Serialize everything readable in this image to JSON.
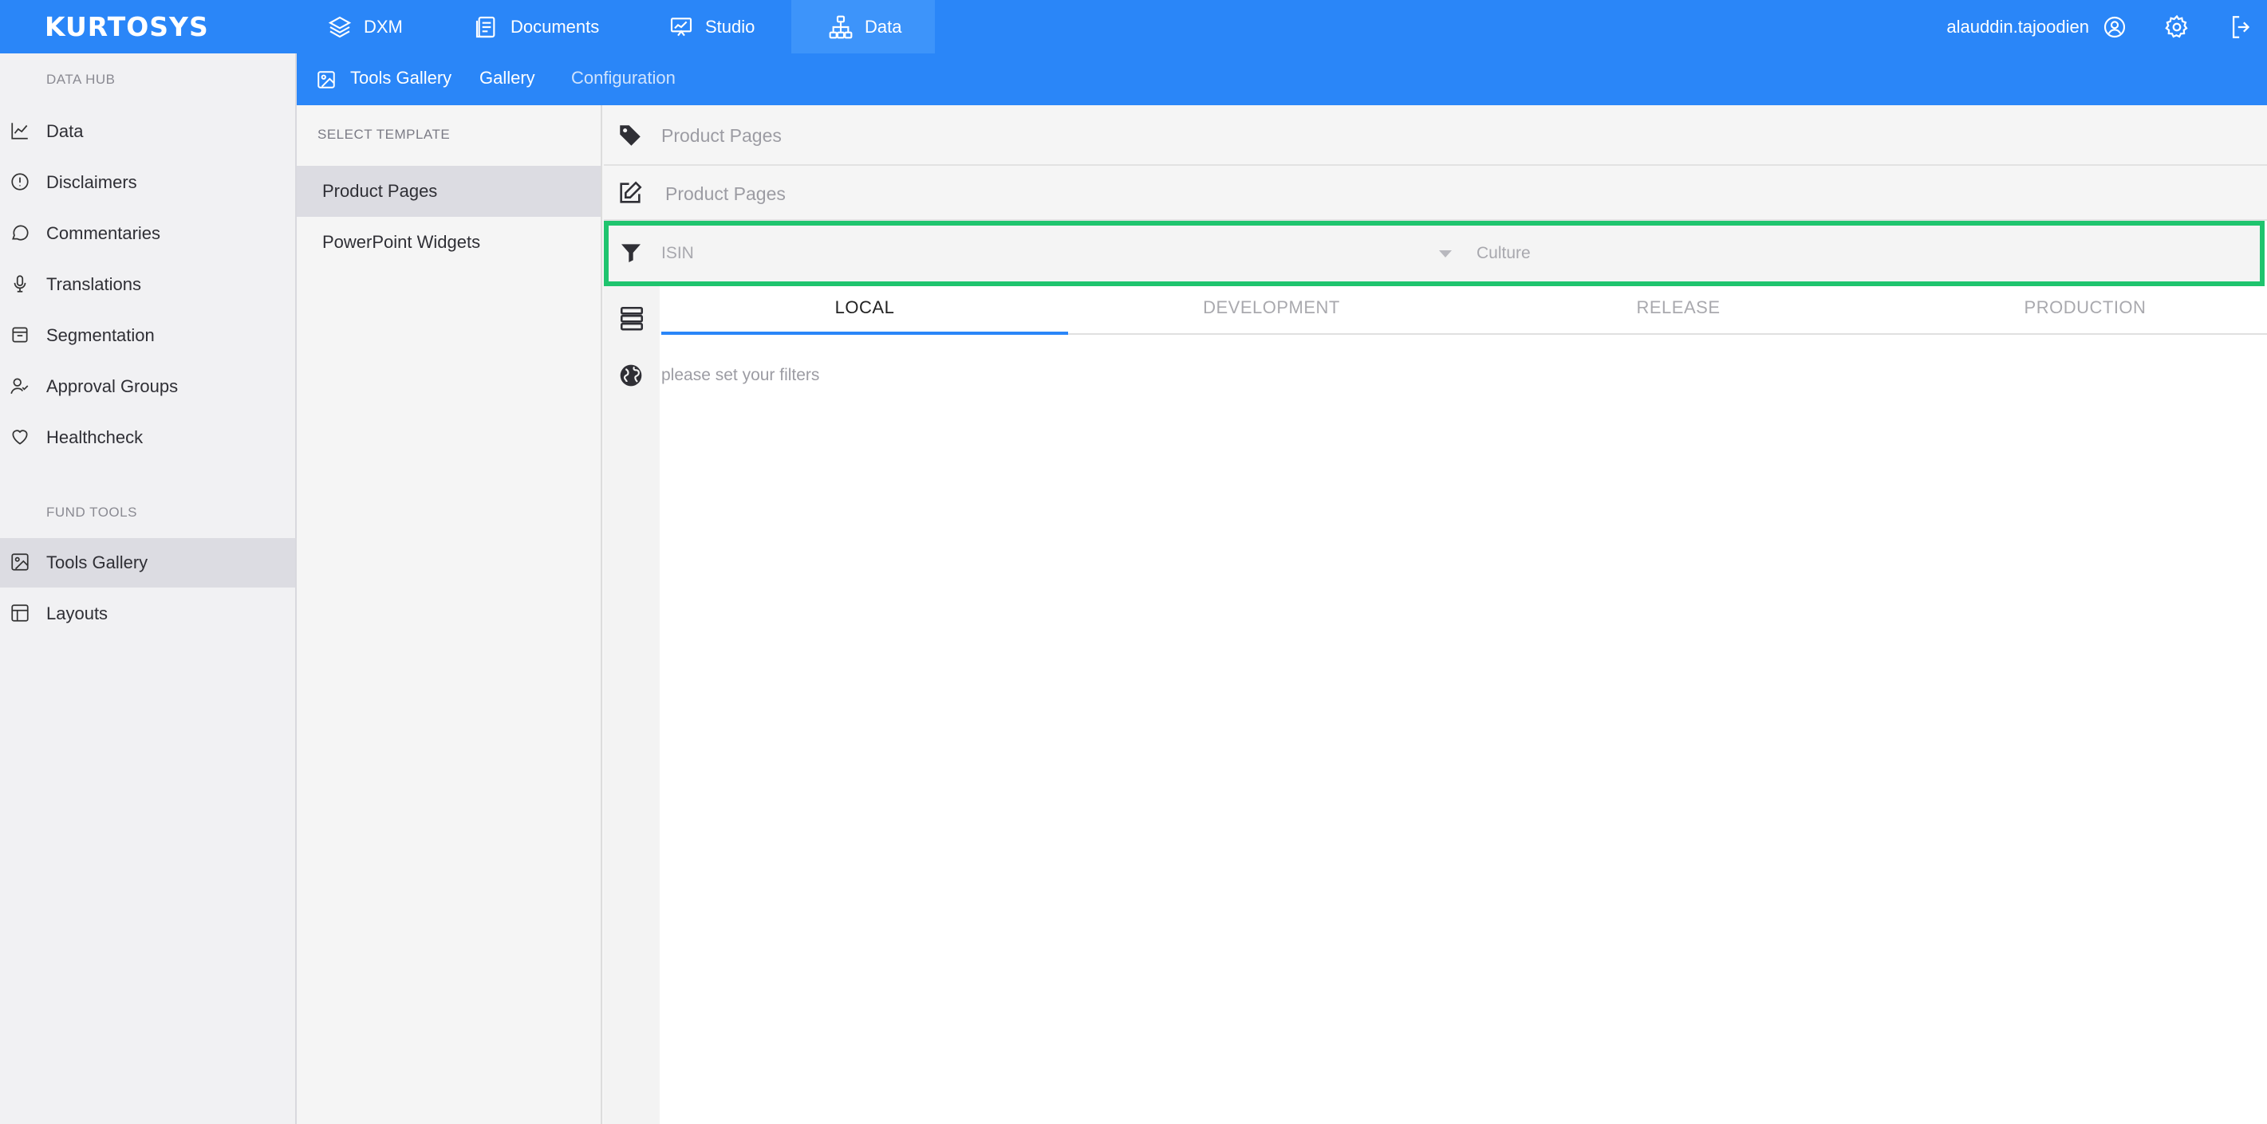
{
  "app": {
    "logo": "KURTOSYS",
    "nav": [
      {
        "label": "DXM",
        "icon": "layers-icon"
      },
      {
        "label": "Documents",
        "icon": "document-icon"
      },
      {
        "label": "Studio",
        "icon": "presentation-icon"
      },
      {
        "label": "Data",
        "icon": "hierarchy-icon",
        "active": true
      }
    ],
    "user": "alauddin.tajoodien"
  },
  "sidebar": {
    "section1": "DATA HUB",
    "items1": [
      {
        "label": "Data",
        "icon": "chart-line-icon"
      },
      {
        "label": "Disclaimers",
        "icon": "alert-circle-icon"
      },
      {
        "label": "Commentaries",
        "icon": "comment-icon"
      },
      {
        "label": "Translations",
        "icon": "microphone-icon"
      },
      {
        "label": "Segmentation",
        "icon": "inbox-icon"
      },
      {
        "label": "Approval Groups",
        "icon": "user-check-icon"
      },
      {
        "label": "Healthcheck",
        "icon": "heart-icon"
      }
    ],
    "section2": "FUND TOOLS",
    "items2": [
      {
        "label": "Tools Gallery",
        "icon": "image-icon",
        "active": true
      },
      {
        "label": "Layouts",
        "icon": "layout-icon"
      }
    ]
  },
  "subheader": {
    "crumbs": [
      "Tools Gallery",
      "Gallery",
      "Configuration"
    ]
  },
  "templates": {
    "header": "SELECT TEMPLATE",
    "items": [
      {
        "label": "Product Pages",
        "active": true
      },
      {
        "label": "PowerPoint Widgets"
      }
    ]
  },
  "main": {
    "tag_value": "Product Pages",
    "name_value": "Product Pages",
    "filters": {
      "isin_placeholder": "ISIN",
      "culture_placeholder": "Culture"
    },
    "tabs": [
      "LOCAL",
      "DEVELOPMENT",
      "RELEASE",
      "PRODUCTION"
    ],
    "active_tab": "LOCAL",
    "message": "please set your filters"
  },
  "colors": {
    "brand": "#2a86f8",
    "highlight": "#1fc46e"
  }
}
